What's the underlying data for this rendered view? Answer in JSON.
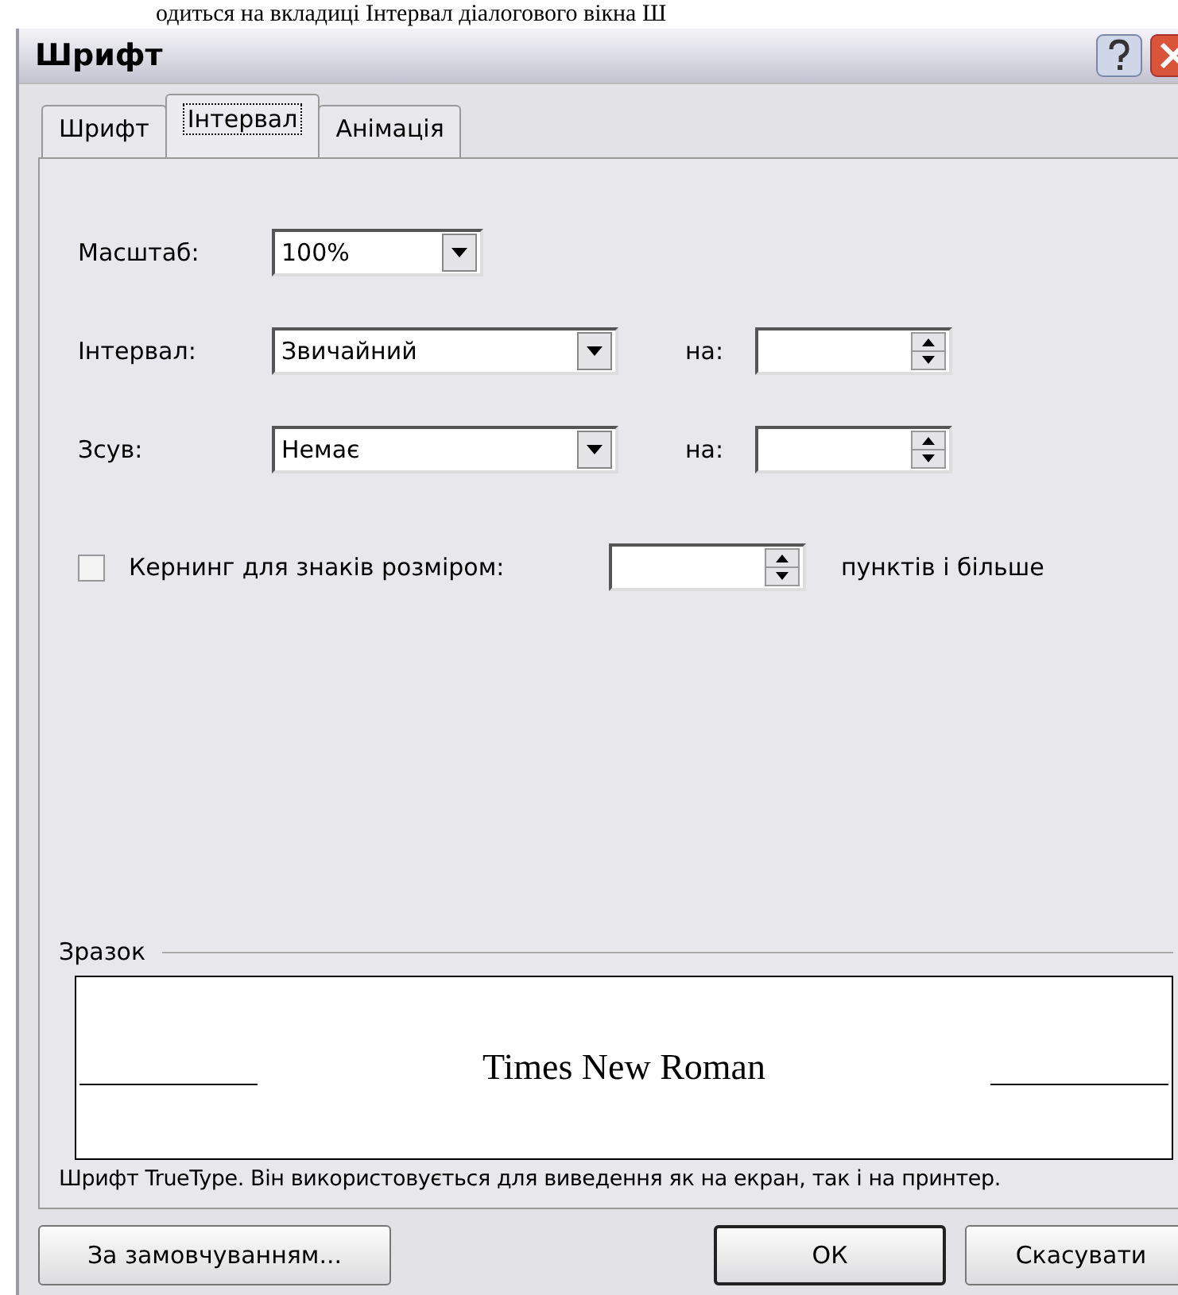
{
  "page_text": "одиться на вкладиці Інтервал діалогового вікна Ш",
  "window": {
    "title": "Шрифт"
  },
  "tabs": [
    {
      "label": "Шрифт",
      "selected": false
    },
    {
      "label": "Інтервал",
      "selected": true
    },
    {
      "label": "Анімація",
      "selected": false
    }
  ],
  "scale": {
    "label": "Масштаб:",
    "value": "100%"
  },
  "rows": [
    {
      "label": "Інтервал:",
      "value": "Звичайний",
      "by_label": "на:"
    },
    {
      "label": "Зсув:",
      "value": "Немає",
      "by_label": "на:"
    }
  ],
  "kerning": {
    "label": "Кернинг для знаків розміром:",
    "checked": false,
    "suffix": "пунктів і більше"
  },
  "preview": {
    "label": "Зразок",
    "sample": "Times New Roman",
    "note": "Шрифт TrueType. Він використовується для виведення як на екран, так і на принтер."
  },
  "buttons": [
    {
      "label": "За замовчуванням...",
      "kind": "left",
      "default": false
    },
    {
      "label": "ОК",
      "kind": "right",
      "default": true
    },
    {
      "label": "Скасувати",
      "kind": "right",
      "default": false
    }
  ]
}
